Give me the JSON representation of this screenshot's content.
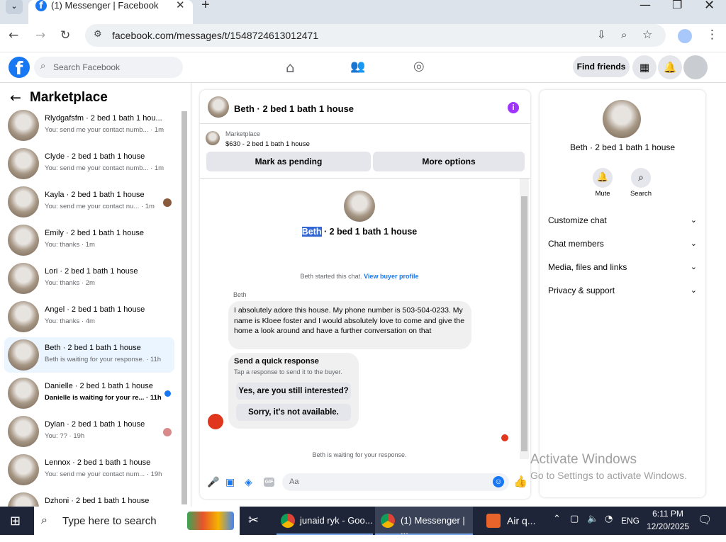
{
  "browser": {
    "tab_title": "(1) Messenger | Facebook",
    "tab_favicon": "f",
    "url": "facebook.com/messages/t/1548724613012471",
    "new_tab": "+",
    "close": "✕"
  },
  "fb_header": {
    "logo": "f",
    "search_placeholder": "Search Facebook",
    "find_friends": "Find friends"
  },
  "sidebar": {
    "title": "Marketplace",
    "conversations": [
      {
        "name": "Rlydgafsfm · 2 bed 1 bath 1 hou...",
        "preview": "You: send me your contact numb... · 1m"
      },
      {
        "name": "Clyde · 2 bed 1 bath 1 house",
        "preview": "You: send me your contact numb... · 1m"
      },
      {
        "name": "Kayla · 2 bed 1 bath 1 house",
        "preview": "You: send me your contact nu... · 1m"
      },
      {
        "name": "Emily · 2 bed 1 bath 1 house",
        "preview": "You: thanks · 1m"
      },
      {
        "name": "Lori · 2 bed 1 bath 1 house",
        "preview": "You: thanks · 2m"
      },
      {
        "name": "Angel · 2 bed 1 bath 1 house",
        "preview": "You: thanks · 4m"
      },
      {
        "name": "Beth · 2 bed 1 bath 1 house",
        "preview": "Beth is waiting for your response. · 11h"
      },
      {
        "name": "Danielle · 2 bed 1 bath 1 house",
        "preview": "Danielle is waiting for your re... · 11h"
      },
      {
        "name": "Dylan · 2 bed 1 bath 1 house",
        "preview": "You: ?? · 19h"
      },
      {
        "name": "Lennox · 2 bed 1 bath 1 house",
        "preview": "You: send me your contact num... · 19h"
      },
      {
        "name": "Dzhoni · 2 bed 1 bath 1 house",
        "preview": ""
      }
    ]
  },
  "chat": {
    "header_title": "Beth · 2 bed 1 bath 1 house",
    "listing_source": "Marketplace",
    "listing_detail": "$630 - 2 bed 1 bath 1 house",
    "mark_pending": "Mark as pending",
    "more_options": "More options",
    "intro_name": "Beth",
    "intro_rest": " · 2 bed 1 bath 1 house",
    "started_text": "Beth started this chat. ",
    "view_buyer_profile": "View buyer profile",
    "sender": "Beth",
    "message": "I absolutely adore this house. My phone number is 503-504-0233. My name is Kloee foster and I would absolutely love to come and give the home a look around and have a further conversation on that",
    "quick_title": "Send a quick response",
    "quick_sub": "Tap a response to send it to the buyer.",
    "quick_1": "Yes, are you still interested?",
    "quick_2": "Sorry, it's not available.",
    "waiting": "Beth is waiting for your response.",
    "composer_placeholder": "Aa",
    "gif_label": "GIF"
  },
  "right_panel": {
    "name": "Beth · 2 bed 1 bath 1 house",
    "mute": "Mute",
    "search": "Search",
    "menu": [
      "Customize chat",
      "Chat members",
      "Media, files and links",
      "Privacy & support"
    ]
  },
  "watermark": {
    "line1": "Activate Windows",
    "line2": "Go to Settings to activate Windows."
  },
  "taskbar": {
    "search": "Type here to search",
    "app1": "junaid ryk - Goo...",
    "app2": "(1) Messenger | ...",
    "weather": "Air q...",
    "lang": "ENG",
    "time": "6:11 PM",
    "date": "12/20/2025"
  },
  "colors": {
    "accent": "#1877f2",
    "purple": "#a033ff",
    "taskbar": "#1e2538"
  }
}
